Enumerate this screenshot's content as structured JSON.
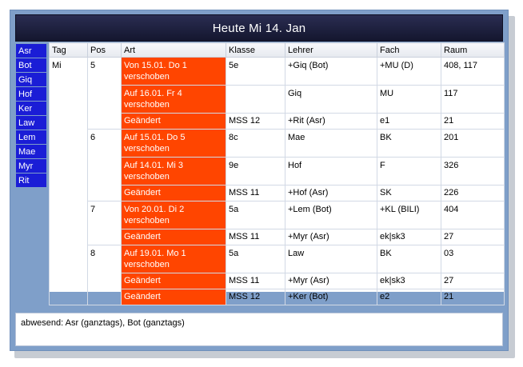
{
  "header": {
    "title": "Heute Mi 14. Jan"
  },
  "sidebar": {
    "items": [
      "Asr",
      "Bot",
      "Giq",
      "Hof",
      "Ker",
      "Law",
      "Lem",
      "Mae",
      "Myr",
      "Rit"
    ]
  },
  "table": {
    "columns": [
      "Tag",
      "Pos",
      "Art",
      "Klasse",
      "Lehrer",
      "Fach",
      "Raum"
    ],
    "tag": "Mi",
    "groups": [
      {
        "pos": "5",
        "rows": [
          {
            "art": "Von 15.01. Do 1 verschoben",
            "klasse": "5e",
            "lehrer": "+Giq (Bot)",
            "fach": "+MU (D)",
            "raum": "408, 117"
          },
          {
            "art": "Auf 16.01. Fr 4 verschoben",
            "klasse": "",
            "lehrer": "Giq",
            "fach": "MU",
            "raum": "117"
          },
          {
            "art": "Geändert",
            "klasse": "MSS 12",
            "lehrer": "+Rit (Asr)",
            "fach": "e1",
            "raum": "21"
          }
        ]
      },
      {
        "pos": "6",
        "rows": [
          {
            "art": "Auf 15.01. Do 5 verschoben",
            "klasse": "8c",
            "lehrer": "Mae",
            "fach": "BK",
            "raum": "201"
          },
          {
            "art": "Auf 14.01. Mi 3 verschoben",
            "klasse": "9e",
            "lehrer": "Hof",
            "fach": "F",
            "raum": "326"
          },
          {
            "art": "Geändert",
            "klasse": "MSS 11",
            "lehrer": "+Hof (Asr)",
            "fach": "SK",
            "raum": "226"
          }
        ]
      },
      {
        "pos": "7",
        "rows": [
          {
            "art": "Von 20.01. Di 2 verschoben",
            "klasse": "5a",
            "lehrer": "+Lem (Bot)",
            "fach": "+KL (BILI)",
            "raum": "404"
          },
          {
            "art": "Geändert",
            "klasse": "MSS 11",
            "lehrer": "+Myr (Asr)",
            "fach": "ek|sk3",
            "raum": "27"
          }
        ]
      },
      {
        "pos": "8",
        "rows": [
          {
            "art": "Auf 19.01. Mo 1 verschoben",
            "klasse": "5a",
            "lehrer": "Law",
            "fach": "BK",
            "raum": "03"
          },
          {
            "art": "Geändert",
            "klasse": "MSS 11",
            "lehrer": "+Myr (Asr)",
            "fach": "ek|sk3",
            "raum": "27"
          },
          {
            "art": "Geändert",
            "klasse": "MSS 12",
            "lehrer": "+Ker (Bot)",
            "fach": "e2",
            "raum": "21"
          }
        ]
      }
    ]
  },
  "footer": {
    "absent": "abwesend: Asr (ganztags), Bot (ganztags)"
  },
  "colors": {
    "art_bg": "#ff4500",
    "sidebar_bg": "#1a1dd6",
    "frame_bg": "#7f9fc9",
    "header_bg": "#1e2140"
  }
}
